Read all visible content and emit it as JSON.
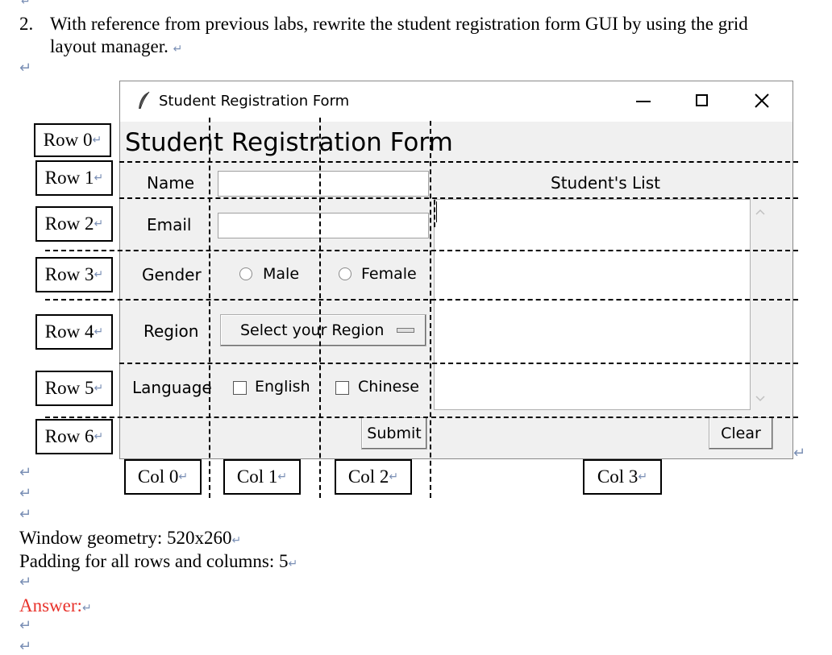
{
  "doc": {
    "top_mark": "↵",
    "question_number": "2.",
    "question_line1": "With reference from previous labs, rewrite the student registration form GUI by using the grid",
    "question_line2": "layout manager.",
    "para_mark": "↵",
    "geometry_text": "Window geometry: 520x260",
    "padding_text": "Padding for all rows and columns: 5",
    "answer_label": "Answer:",
    "answer_color": "#e8322b"
  },
  "row_labels": [
    "Row 0",
    "Row 1",
    "Row 2",
    "Row 3",
    "Row 4",
    "Row 5",
    "Row 6"
  ],
  "col_labels": [
    "Col 0",
    "Col 1",
    "Col 2",
    "Col 3"
  ],
  "window": {
    "title": "Student Registration Form",
    "icon": "feather-icon",
    "minimize_icon": "minimize-icon",
    "maximize_icon": "maximize-icon",
    "close_icon": "close-icon"
  },
  "form": {
    "heading": "Student Registration Form",
    "name_label": "Name",
    "email_label": "Email",
    "gender_label": "Gender",
    "male_label": "Male",
    "female_label": "Female",
    "region_label": "Region",
    "region_selected": "Select your Region",
    "language_label": "Language",
    "english_label": "English",
    "chinese_label": "Chinese",
    "submit_label": "Submit",
    "list_title": "Student's List",
    "clear_label": "Clear",
    "name_value": "",
    "email_value": ""
  }
}
